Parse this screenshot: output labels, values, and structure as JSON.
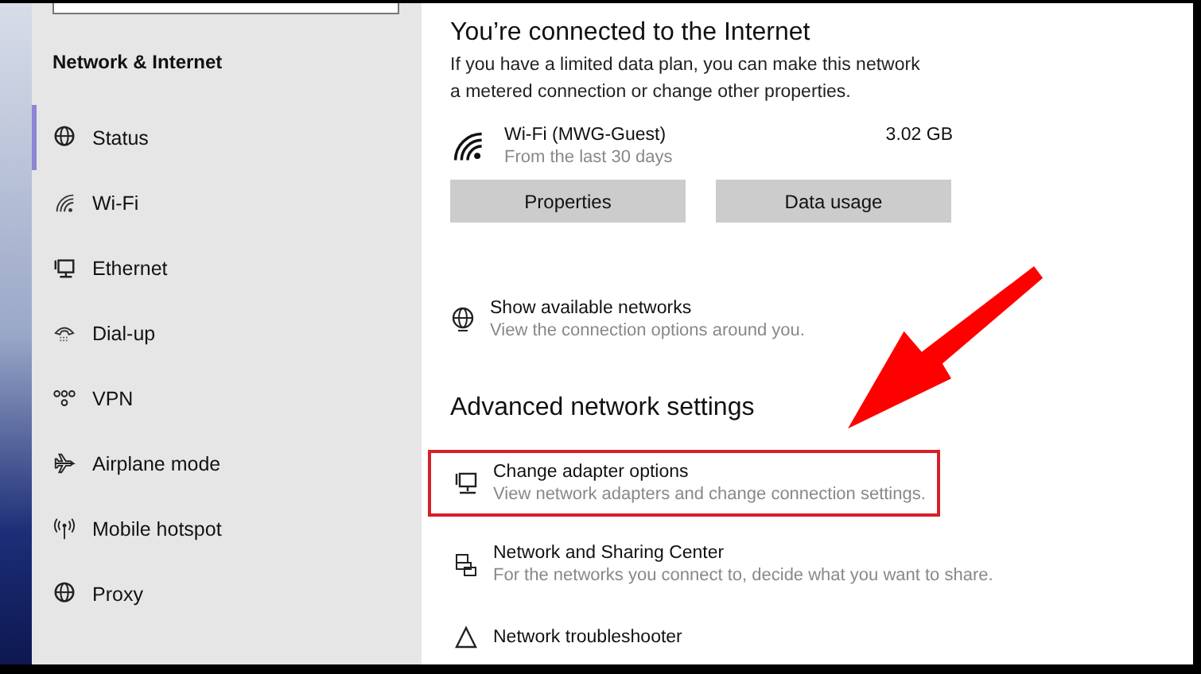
{
  "sidebar": {
    "title": "Network & Internet",
    "items": [
      {
        "label": "Status",
        "kind": "status",
        "selected": true
      },
      {
        "label": "Wi-Fi",
        "kind": "wifi",
        "selected": false
      },
      {
        "label": "Ethernet",
        "kind": "ethernet",
        "selected": false
      },
      {
        "label": "Dial-up",
        "kind": "dialup",
        "selected": false
      },
      {
        "label": "VPN",
        "kind": "vpn",
        "selected": false
      },
      {
        "label": "Airplane mode",
        "kind": "airplane",
        "selected": false
      },
      {
        "label": "Mobile hotspot",
        "kind": "hotspot",
        "selected": false
      },
      {
        "label": "Proxy",
        "kind": "proxy",
        "selected": false
      }
    ]
  },
  "status": {
    "heading": "You’re connected to the Internet",
    "description": "If you have a limited data plan, you can make this network a metered connection or change other properties.",
    "network": {
      "name": "Wi-Fi (MWG-Guest)",
      "detail": "From the last 30 days",
      "usage": "3.02 GB"
    },
    "buttons": [
      "Properties",
      "Data usage"
    ]
  },
  "show_networks": {
    "title": "Show available networks",
    "description": "View the connection options around you."
  },
  "advanced": {
    "heading": "Advanced network settings",
    "items": [
      {
        "title": "Change adapter options",
        "description": "View network adapters and change connection settings.",
        "kind": "adapter",
        "highlighted": true
      },
      {
        "title": "Network and Sharing Center",
        "description": "For the networks you connect to, decide what you want to share.",
        "kind": "sharing",
        "highlighted": false
      },
      {
        "title": "Network troubleshooter",
        "kind": "troubleshooter",
        "highlighted": false
      }
    ]
  }
}
